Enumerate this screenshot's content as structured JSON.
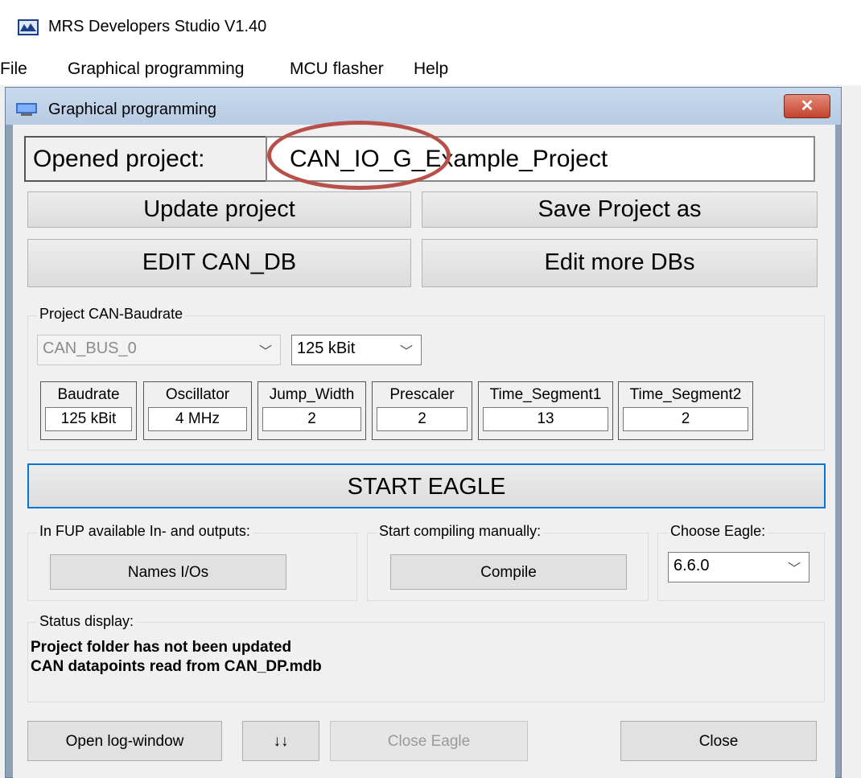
{
  "app": {
    "title": "MRS Developers Studio V1.40",
    "menu": [
      "File",
      "Graphical programming",
      "MCU flasher",
      "Help"
    ]
  },
  "window": {
    "title": "Graphical programming",
    "close_glyph": "✕"
  },
  "project": {
    "label": "Opened project:",
    "name": "CAN_IO_G_Example_Project"
  },
  "buttons": {
    "update_project": "Update project",
    "save_project_as": "Save Project as",
    "edit_can_db": "EDIT CAN_DB",
    "edit_more_dbs": "Edit more DBs",
    "start_eagle": "START EAGLE",
    "names_ios": "Names I/Os",
    "compile": "Compile",
    "open_log": "Open log-window",
    "arrows": "↓↓",
    "close_eagle": "Close Eagle",
    "close": "Close"
  },
  "baudrate_group": {
    "label": "Project CAN-Baudrate",
    "bus_select": "CAN_BUS_0",
    "rate_select": "125 kBit",
    "params": [
      {
        "label": "Baudrate",
        "value": "125 kBit"
      },
      {
        "label": "Oscillator",
        "value": "4 MHz"
      },
      {
        "label": "Jump_Width",
        "value": "2"
      },
      {
        "label": "Prescaler",
        "value": "2"
      },
      {
        "label": "Time_Segment1",
        "value": "13"
      },
      {
        "label": "Time_Segment2",
        "value": "2"
      }
    ]
  },
  "fup_group": {
    "label": "In FUP available In- and outputs:"
  },
  "compile_group": {
    "label": "Start compiling manually:"
  },
  "eagle_group": {
    "label": "Choose Eagle:",
    "version": "6.6.0"
  },
  "status": {
    "label": "Status display:",
    "lines": [
      "Project folder has not been updated",
      "CAN datapoints read from CAN_DP.mdb"
    ]
  },
  "colors": {
    "accent_border": "#0078d7",
    "highlight_ellipse": "#b94f49",
    "close_button": "#c3422c"
  }
}
